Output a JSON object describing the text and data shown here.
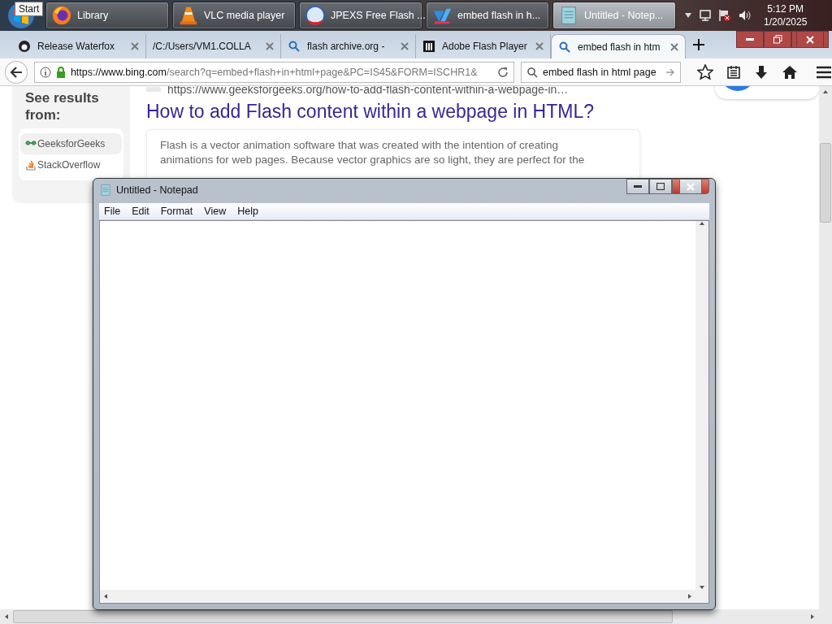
{
  "taskbar": {
    "start_tooltip": "Start",
    "buttons": [
      {
        "label": "Library",
        "kind": "firefox",
        "selected": false
      },
      {
        "label": "VLC media player",
        "kind": "vlc",
        "selected": false
      },
      {
        "label": "JPEXS Free Flash ...",
        "kind": "ffdec",
        "selected": false
      },
      {
        "label": "embed flash in h...",
        "kind": "editor",
        "selected": false
      },
      {
        "label": "Untitled - Notep...",
        "kind": "notepad",
        "selected": true
      }
    ],
    "tray": {
      "time": "5:12 PM",
      "date": "1/20/2025"
    }
  },
  "browser": {
    "tabs": [
      {
        "label": "Release Waterfox",
        "kind": "github",
        "selected": false
      },
      {
        "label": "/C:/Users/VM1.COLLA",
        "kind": "file",
        "selected": false
      },
      {
        "label": "flash archive.org -",
        "kind": "search",
        "selected": false
      },
      {
        "label": "Adobe Flash Player",
        "kind": "library",
        "selected": false
      },
      {
        "label": "embed flash in htm",
        "kind": "search",
        "selected": true
      }
    ],
    "url": {
      "host": "https://www.bing.com",
      "path": "/search?q=embed+flash+in+html+page&PC=IS45&FORM=ISCHR1&"
    },
    "search": "embed flash in html page"
  },
  "page": {
    "sidebar": {
      "heading": "See results from:",
      "items": [
        {
          "label": "GeeksforGeeks",
          "kind": "geeks",
          "selected": true
        },
        {
          "label": "StackOverflow",
          "kind": "stack",
          "selected": false
        }
      ]
    },
    "result": {
      "url": "https://www.geeksforgeeks.org/how-to-add-flash-content-within-a-webpage-in…",
      "title": "How to add Flash content within a webpage in HTML?",
      "snippet": [
        "Flash is a vector animation software that was created with the intention of creating",
        "animations for web pages. Because vector graphics are so light, they are perfect for the"
      ]
    }
  },
  "notepad": {
    "title": "Untitled - Notepad",
    "menu": [
      "File",
      "Edit",
      "Format",
      "View",
      "Help"
    ]
  }
}
